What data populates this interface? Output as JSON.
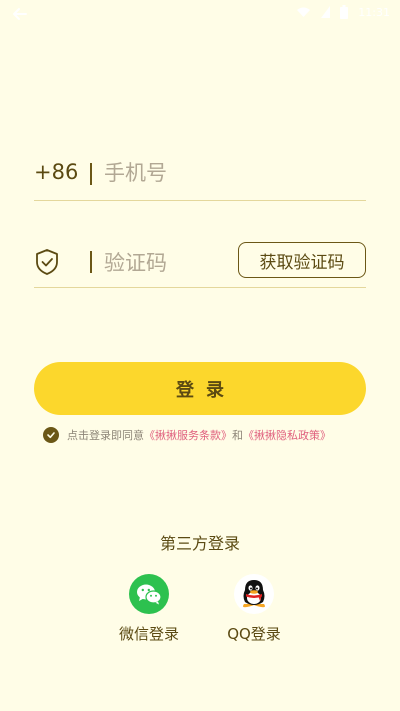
{
  "status_bar": {
    "time": "11:31"
  },
  "phone": {
    "country_code": "+86",
    "placeholder": "手机号",
    "value": ""
  },
  "verification": {
    "placeholder": "验证码",
    "value": "",
    "get_code_label": "获取验证码"
  },
  "login_button": "登录",
  "agreement": {
    "checked": true,
    "prefix": "点击登录即同意",
    "terms_link": "《揪揪服务条款》",
    "and": "和",
    "privacy_link": "《揪揪隐私政策》"
  },
  "third_party": {
    "title": "第三方登录",
    "options": [
      {
        "label": "微信登录",
        "icon": "wechat-icon"
      },
      {
        "label": "QQ登录",
        "icon": "qq-icon"
      }
    ]
  },
  "colors": {
    "background": "#FFFDE7",
    "accent": "#FCD72C",
    "text": "#5B4A12",
    "link": "#E0607E",
    "wechat": "#2DC14F"
  }
}
